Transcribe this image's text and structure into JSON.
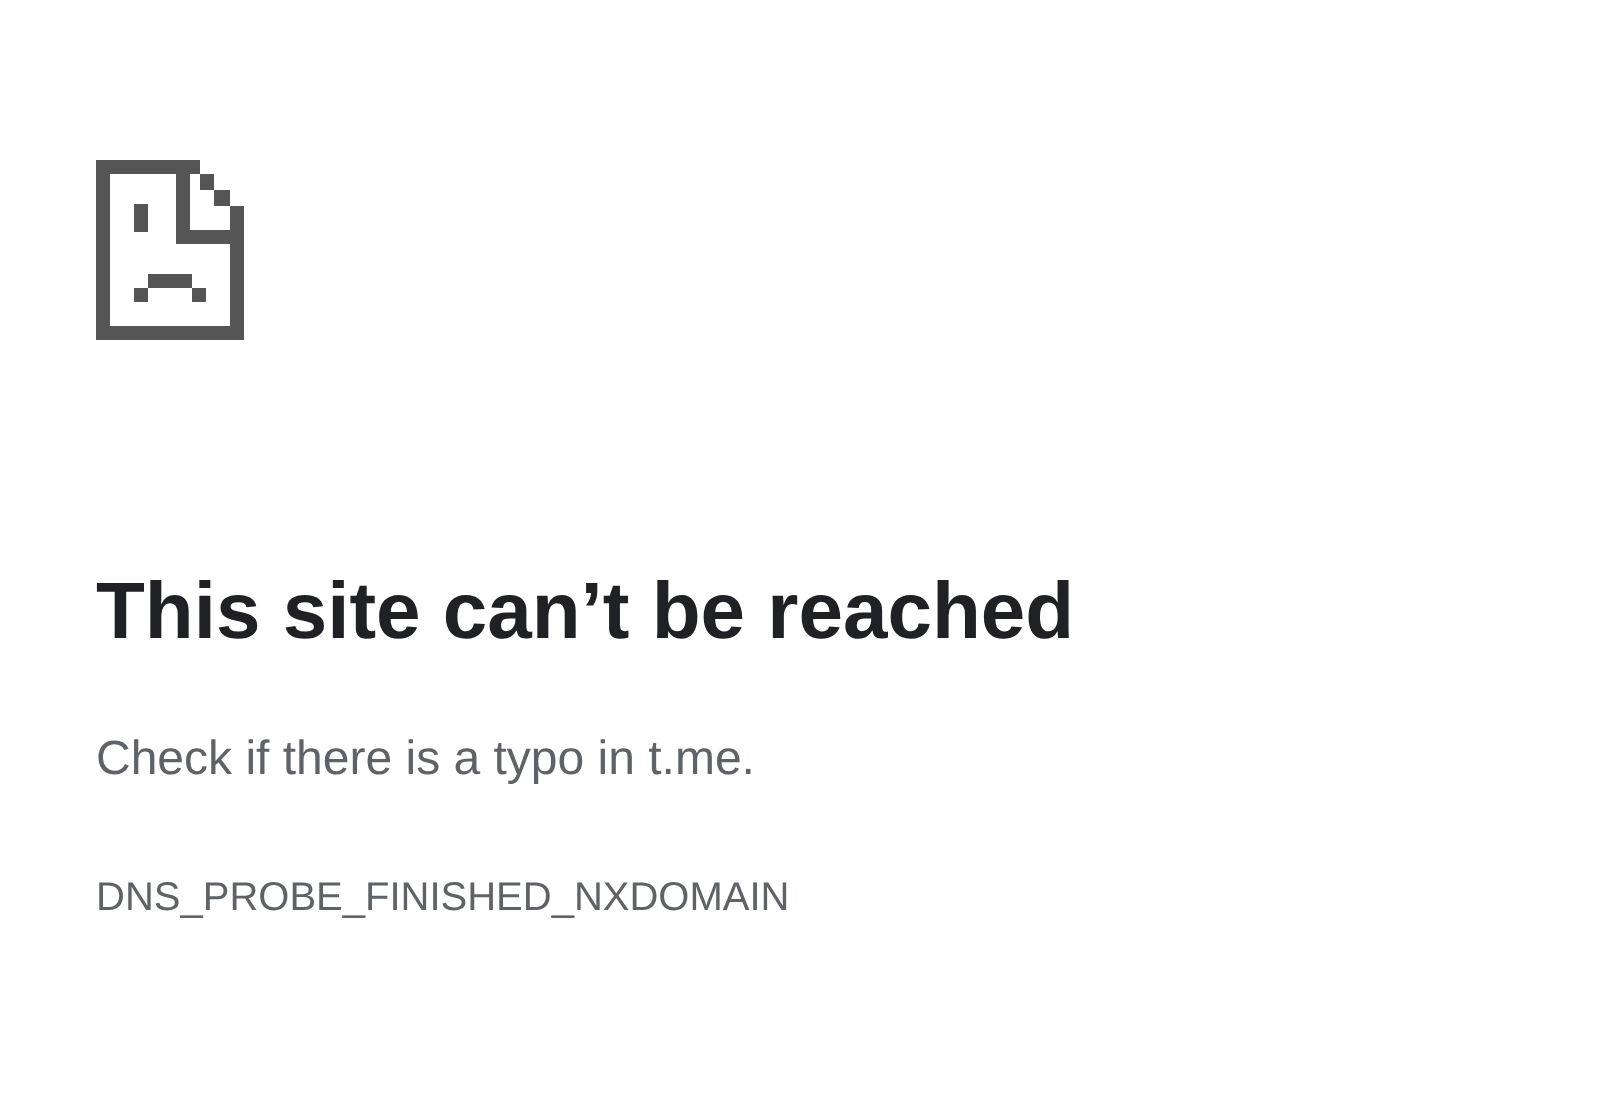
{
  "heading": "This site can’t be reached",
  "message": "Check if there is a typo in t.me.",
  "error_code": "DNS_PROBE_FINISHED_NXDOMAIN"
}
